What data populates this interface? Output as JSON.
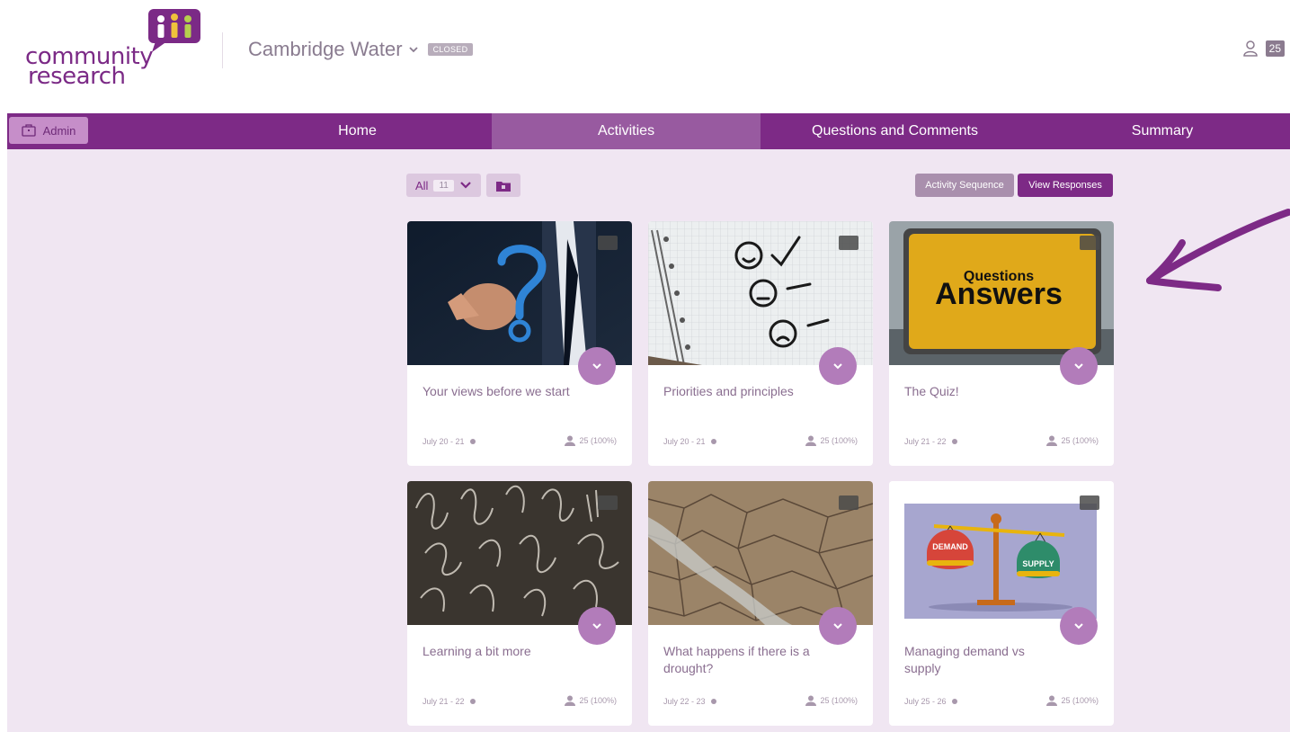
{
  "header": {
    "logo_line1": "community",
    "logo_line2": "research",
    "project_name": "Cambridge Water",
    "project_status": "CLOSED",
    "participant_count": "25"
  },
  "nav": {
    "admin_label": "Admin",
    "items": [
      {
        "label": "Home"
      },
      {
        "label": "Activities"
      },
      {
        "label": "Questions and Comments"
      },
      {
        "label": "Summary"
      }
    ],
    "active": "Activities"
  },
  "toolbar": {
    "filter_label": "All",
    "filter_count": "11",
    "activity_sequence_label": "Activity Sequence",
    "view_responses_label": "View Responses"
  },
  "cards": [
    {
      "title": "Your views before we start",
      "date": "July 20 - 21",
      "responses": "25 (100%)"
    },
    {
      "title": "Priorities and principles",
      "date": "July 20 - 21",
      "responses": "25 (100%)"
    },
    {
      "title": "The Quiz!",
      "date": "July 21 - 22",
      "responses": "25 (100%)"
    },
    {
      "title": "Learning a bit more",
      "date": "July 21 - 22",
      "responses": "25 (100%)"
    },
    {
      "title": "What happens if there is a drought?",
      "date": "July 22 - 23",
      "responses": "25 (100%)"
    },
    {
      "title": "Managing demand vs supply",
      "date": "July 25 - 26",
      "responses": "25 (100%)"
    }
  ],
  "image_text": {
    "qa_small": "Questions",
    "qa_big": "Answers",
    "scale_left": "DEMAND",
    "scale_right": "SUPPLY"
  },
  "colors": {
    "brand_purple": "#7d2a86",
    "nav_active": "#985aa0",
    "content_bg": "#f0e6f2",
    "expand_button": "#b27cba"
  }
}
